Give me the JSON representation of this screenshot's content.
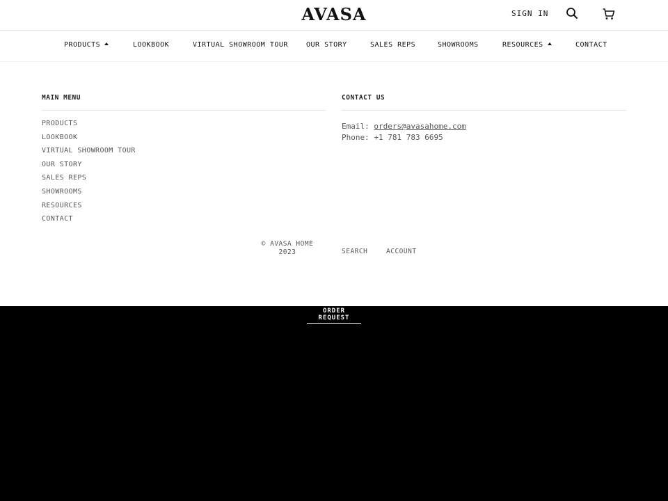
{
  "header": {
    "logo": "AVASA",
    "sign_in": "SIGN IN",
    "icons": {
      "search": "search-icon",
      "cart": "cart-icon"
    }
  },
  "nav": {
    "items": [
      {
        "label": "PRODUCTS",
        "has_dropdown": true
      },
      {
        "label": "LOOKBOOK"
      },
      {
        "label": "VIRTUAL SHOWROOM TOUR"
      },
      {
        "label": "OUR STORY"
      },
      {
        "label": "SALES REPS"
      },
      {
        "label": "SHOWROOMS"
      },
      {
        "label": "RESOURCES",
        "has_dropdown": true
      },
      {
        "label": "CONTACT"
      }
    ]
  },
  "footer": {
    "main_menu": {
      "title": "MAIN MENU",
      "items": [
        "PRODUCTS",
        "LOOKBOOK",
        "VIRTUAL SHOWROOM TOUR",
        "OUR STORY",
        "SALES REPS",
        "SHOWROOMS",
        "RESOURCES",
        "CONTACT"
      ]
    },
    "contact": {
      "title": "CONTACT US",
      "email_label": "Email:",
      "email": "orders@avasahome.com",
      "phone_label": "Phone:",
      "phone": "+1 781 783 6695"
    },
    "copyright_line1": "© AVASA HOME",
    "copyright_line2": "2023",
    "links": {
      "search": "SEARCH",
      "account": "ACCOUNT"
    }
  },
  "order_request": "ORDER REQUEST",
  "colors": {
    "background_dark": "#000000",
    "page": "#ffffff",
    "text": "#111111",
    "muted": "#555555"
  }
}
